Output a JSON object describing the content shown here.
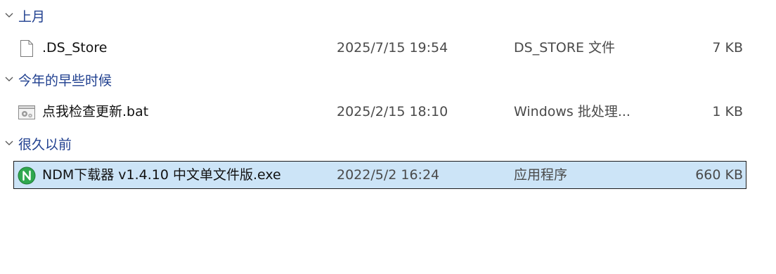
{
  "groups": [
    {
      "label": "上月",
      "files": [
        {
          "name": ".DS_Store",
          "date": "2025/7/15 19:54",
          "type": "DS_STORE 文件",
          "size": "7 KB",
          "icon": "blank-file-icon"
        }
      ]
    },
    {
      "label": "今年的早些时候",
      "files": [
        {
          "name": "点我检查更新.bat",
          "date": "2025/2/15 18:10",
          "type": "Windows 批处理...",
          "size": "1 KB",
          "icon": "batch-file-icon"
        }
      ]
    },
    {
      "label": "很久以前",
      "files": [
        {
          "name": "NDM下载器 v1.4.10 中文单文件版.exe",
          "date": "2022/5/2 16:24",
          "type": "应用程序",
          "size": "660 KB",
          "icon": "ndm-app-icon",
          "selected": true
        }
      ]
    }
  ],
  "colors": {
    "group_label": "#1f3f8f",
    "selection_fill": "#cce4f7",
    "selection_border": "#1b1b1b",
    "app_icon_green": "#2fa84f"
  }
}
